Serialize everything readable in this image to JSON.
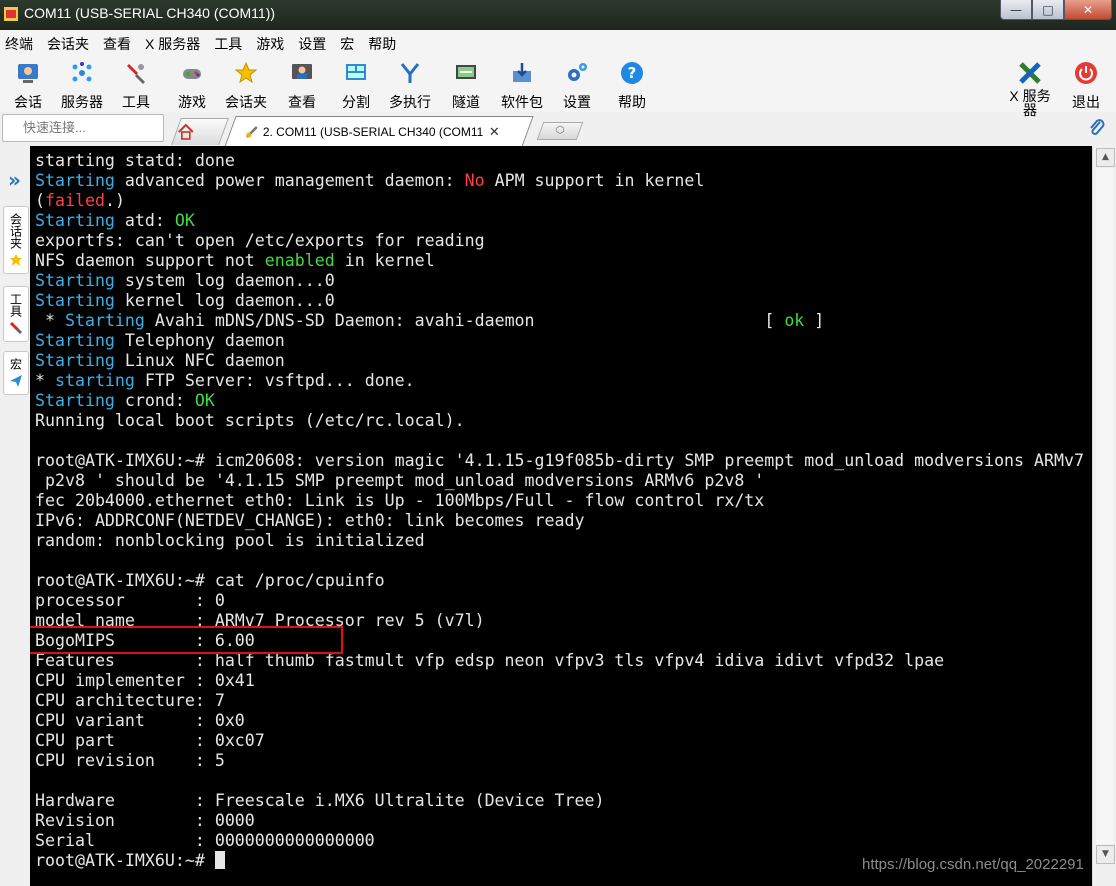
{
  "window": {
    "title": "COM11  (USB-SERIAL CH340 (COM11))",
    "buttons": {
      "minimize": "—",
      "maximize": "□",
      "close": "✕"
    }
  },
  "menu": [
    "终端",
    "会话夹",
    "查看",
    "X 服务器",
    "工具",
    "游戏",
    "设置",
    "宏",
    "帮助"
  ],
  "toolbar": {
    "items": [
      {
        "label": "会话",
        "icon": "session-icon"
      },
      {
        "label": "服务器",
        "icon": "servers-icon"
      },
      {
        "label": "工具",
        "icon": "tools-icon"
      },
      {
        "label": "游戏",
        "icon": "games-icon"
      },
      {
        "label": "会话夹",
        "icon": "star-icon"
      },
      {
        "label": "查看",
        "icon": "view-icon"
      },
      {
        "label": "分割",
        "icon": "split-icon"
      },
      {
        "label": "多执行",
        "icon": "multiexec-icon"
      },
      {
        "label": "隧道",
        "icon": "tunnel-icon"
      },
      {
        "label": "软件包",
        "icon": "packages-icon"
      },
      {
        "label": "设置",
        "icon": "settings-icon"
      },
      {
        "label": "帮助",
        "icon": "help-icon"
      }
    ],
    "xserver_line1": "X 服务",
    "xserver_line2": "器",
    "exit": "退出"
  },
  "quick_connect": {
    "placeholder": "快速连接..."
  },
  "tab": {
    "label": "2. COM11  (USB-SERIAL CH340 (COM11))",
    "close": "✕",
    "new_tab": "⬡"
  },
  "sidebar": {
    "sessions": "会话夹",
    "tools": "工具",
    "macros": "宏"
  },
  "terminal": {
    "lines": [
      [
        {
          "t": "starting statd: done"
        }
      ],
      [
        {
          "t": "Starting",
          "c": "cyan"
        },
        {
          "t": " advanced power management daemon: "
        },
        {
          "t": "No",
          "c": "red"
        },
        {
          "t": " APM support in kernel"
        }
      ],
      [
        {
          "t": "("
        },
        {
          "t": "failed",
          "c": "red"
        },
        {
          "t": ".)"
        }
      ],
      [
        {
          "t": "Starting",
          "c": "cyan"
        },
        {
          "t": " atd: "
        },
        {
          "t": "OK",
          "c": "green"
        }
      ],
      [
        {
          "t": "exportfs: can't open /etc/exports for reading"
        }
      ],
      [
        {
          "t": "NFS daemon support not "
        },
        {
          "t": "enabled",
          "c": "green"
        },
        {
          "t": " in kernel"
        }
      ],
      [
        {
          "t": "Starting",
          "c": "cyan"
        },
        {
          "t": " system log daemon...0"
        }
      ],
      [
        {
          "t": "Starting",
          "c": "cyan"
        },
        {
          "t": " kernel log daemon...0"
        }
      ],
      [
        {
          "t": " * "
        },
        {
          "t": "Starting",
          "c": "cyan"
        },
        {
          "t": " Avahi mDNS/DNS-SD Daemon: avahi-daemon                       [ "
        },
        {
          "t": "ok",
          "c": "green"
        },
        {
          "t": " ]"
        }
      ],
      [
        {
          "t": "Starting",
          "c": "cyan"
        },
        {
          "t": " Telephony daemon"
        }
      ],
      [
        {
          "t": "Starting",
          "c": "cyan"
        },
        {
          "t": " Linux NFC daemon"
        }
      ],
      [
        {
          "t": "* "
        },
        {
          "t": "starting",
          "c": "cyan"
        },
        {
          "t": " FTP Server: vsftpd... done."
        }
      ],
      [
        {
          "t": "Starting",
          "c": "cyan"
        },
        {
          "t": " crond: "
        },
        {
          "t": "OK",
          "c": "green"
        }
      ],
      [
        {
          "t": "Running local boot scripts (/etc/rc.local)."
        }
      ],
      [
        {
          "t": ""
        }
      ],
      [
        {
          "t": "root@ATK-IMX6U:~# icm20608: version magic '4.1.15-g19f085b-dirty SMP preempt mod_unload modversions ARMv7"
        }
      ],
      [
        {
          "t": " p2v8 ' should be '4.1.15 SMP preempt mod_unload modversions ARMv6 p2v8 '"
        }
      ],
      [
        {
          "t": "fec 20b4000.ethernet eth0: Link is Up - 100Mbps/Full - flow control rx/tx"
        }
      ],
      [
        {
          "t": "IPv6: ADDRCONF(NETDEV_CHANGE): eth0: link becomes ready"
        }
      ],
      [
        {
          "t": "random: nonblocking pool is initialized"
        }
      ],
      [
        {
          "t": ""
        }
      ],
      [
        {
          "t": "root@ATK-IMX6U:~# cat /proc/cpuinfo"
        }
      ],
      [
        {
          "t": "processor       : 0"
        }
      ],
      [
        {
          "t": "model name      : ARMv7 Processor rev 5 (v7l)"
        }
      ],
      [
        {
          "t": "BogoMIPS        : 6.00"
        }
      ],
      [
        {
          "t": "Features        : half thumb fastmult vfp edsp neon vfpv3 tls vfpv4 idiva idivt vfpd32 lpae"
        }
      ],
      [
        {
          "t": "CPU implementer : 0x41"
        }
      ],
      [
        {
          "t": "CPU architecture: 7"
        }
      ],
      [
        {
          "t": "CPU variant     : 0x0"
        }
      ],
      [
        {
          "t": "CPU part        : 0xc07"
        }
      ],
      [
        {
          "t": "CPU revision    : 5"
        }
      ],
      [
        {
          "t": ""
        }
      ],
      [
        {
          "t": "Hardware        : Freescale i.MX6 Ultralite (Device Tree)"
        }
      ],
      [
        {
          "t": "Revision        : 0000"
        }
      ],
      [
        {
          "t": "Serial          : 0000000000000000"
        }
      ],
      [
        {
          "t": "root@ATK-IMX6U:~# "
        }
      ]
    ],
    "watermark": "https://blog.csdn.net/qq_2022291"
  },
  "colors": {
    "cyan": "#3ab0e8",
    "red": "#ff4040",
    "green": "#3fdc3f",
    "highlight": "#e01010"
  }
}
